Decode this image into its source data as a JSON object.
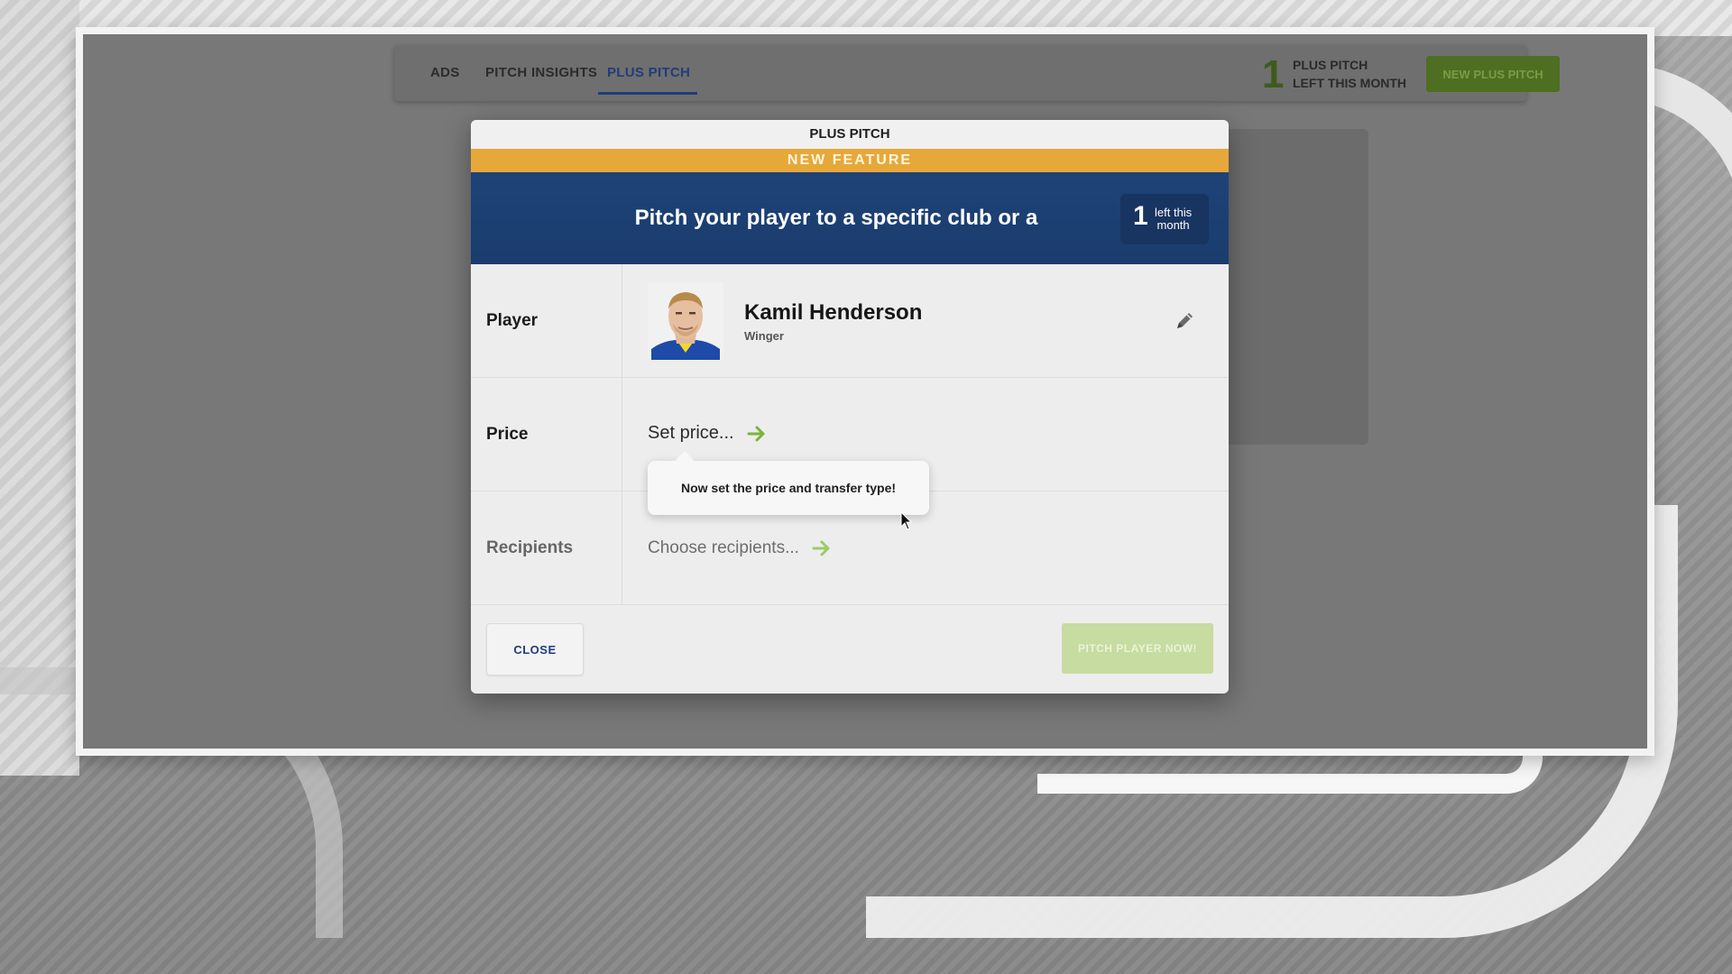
{
  "nav": {
    "tabs": [
      {
        "label": "ADS"
      },
      {
        "label": "PITCH INSIGHTS"
      },
      {
        "label": "PLUS PITCH"
      }
    ],
    "active_tab": "PLUS PITCH",
    "counter_value": "1",
    "counter_line1": "PLUS PITCH",
    "counter_line2": "LEFT THIS MONTH",
    "new_button_label": "NEW PLUS PITCH"
  },
  "modal": {
    "title": "PLUS PITCH",
    "feature_label": "NEW FEATURE",
    "banner_text": "Pitch your player to a specific club or a whole league",
    "badge_count": "1",
    "badge_line1": "left this",
    "badge_line2": "month",
    "rows": {
      "player_label": "Player",
      "player_name": "Kamil Henderson",
      "player_position": "Winger",
      "price_label": "Price",
      "price_placeholder": "Set price...",
      "recipients_label": "Recipients",
      "recipients_placeholder": "Choose recipients..."
    },
    "tooltip": "Now set the price and transfer type!",
    "close_label": "CLOSE",
    "submit_label": "PITCH PLAYER NOW!"
  },
  "colors": {
    "banner_blue": "#1f4378",
    "feature_orange": "#e7a83a",
    "accent_green": "#7bb33a",
    "active_tab_blue": "#1f3d7a"
  },
  "icons": [
    "pencil-icon",
    "arrow-right-icon",
    "cursor-icon"
  ]
}
